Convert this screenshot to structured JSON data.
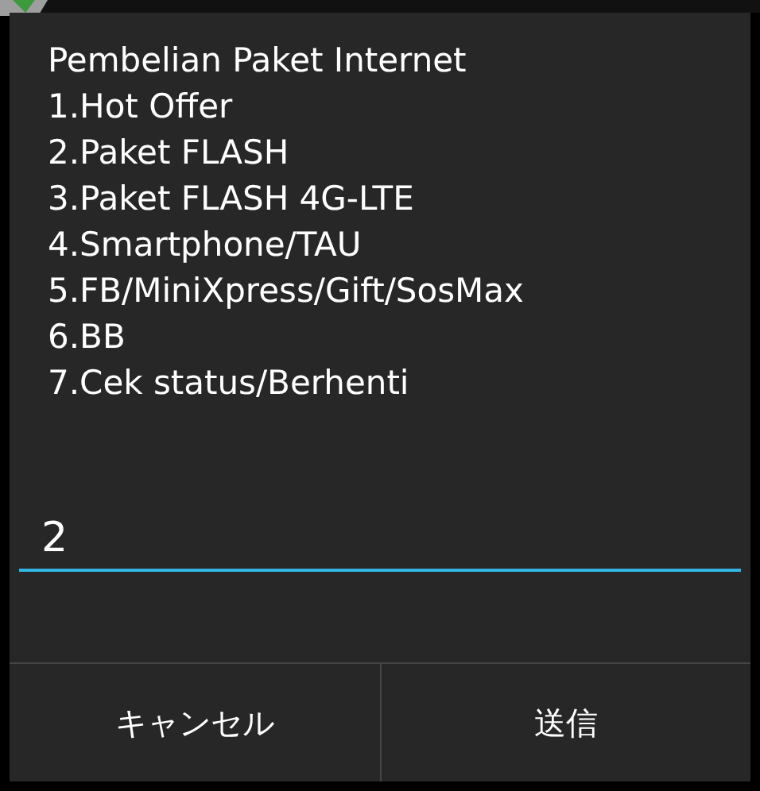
{
  "dialog": {
    "message_lines": [
      "Pembelian Paket Internet",
      "1.Hot Offer",
      "2.Paket FLASH",
      "3.Paket FLASH 4G-LTE",
      "4.Smartphone/TAU",
      "5.FB/MiniXpress/Gift/SosMax",
      "6.BB",
      "7.Cek status/Berhenti"
    ],
    "input": {
      "value": "2"
    },
    "buttons": [
      "キャンセル",
      "送信"
    ]
  }
}
